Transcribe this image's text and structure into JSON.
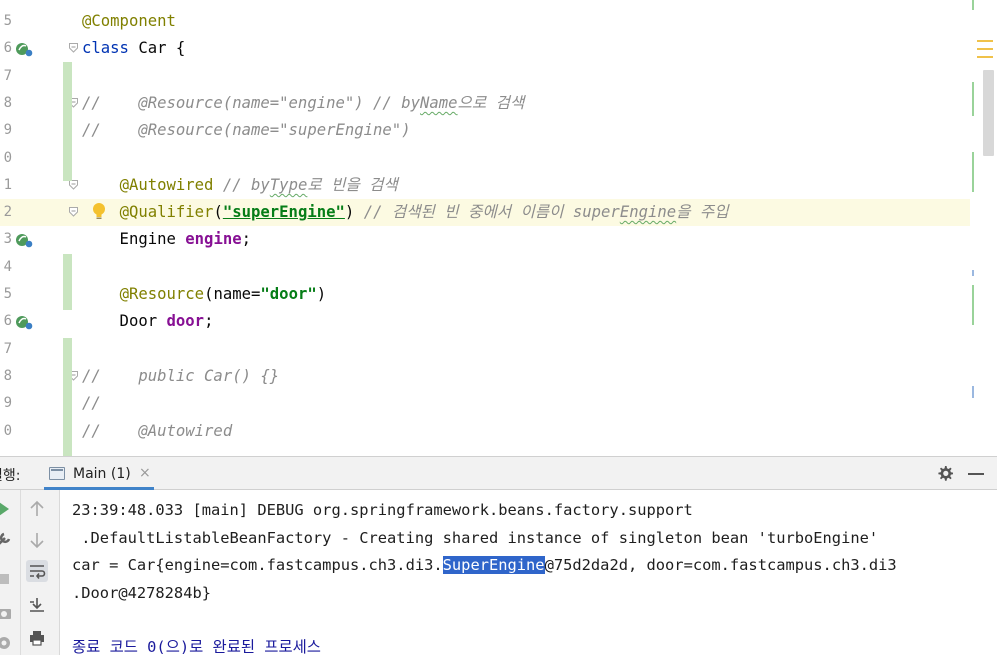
{
  "editor": {
    "lines": [
      {
        "num": "5",
        "segments": [
          {
            "t": "@Component",
            "c": "c-ann"
          }
        ]
      },
      {
        "num": "6",
        "segments": [
          {
            "t": "class",
            "c": "c-kw"
          },
          {
            "t": " Car {",
            "c": "c-plain"
          }
        ]
      },
      {
        "num": "7",
        "segments": []
      },
      {
        "num": "8",
        "segments": [
          {
            "t": "//    @Resource(name=\"engine\") // by",
            "c": "c-cmt"
          },
          {
            "t": "Name",
            "c": "c-cmt sq"
          },
          {
            "t": "으로 검색",
            "c": "c-cmt"
          }
        ]
      },
      {
        "num": "9",
        "segments": [
          {
            "t": "//    @Resource(name=\"superEngine\")",
            "c": "c-cmt"
          }
        ]
      },
      {
        "num": "0",
        "segments": []
      },
      {
        "num": "1",
        "segments": [
          {
            "t": "    ",
            "c": "c-plain"
          },
          {
            "t": "@Autowired",
            "c": "c-ann"
          },
          {
            "t": " // by",
            "c": "c-cmt"
          },
          {
            "t": "Type",
            "c": "c-cmt sq"
          },
          {
            "t": "로 빈을 검색",
            "c": "c-cmt"
          }
        ]
      },
      {
        "num": "2",
        "segments": [
          {
            "t": "    ",
            "c": "c-plain"
          },
          {
            "t": "@Qualifier",
            "c": "c-ann"
          },
          {
            "t": "(",
            "c": "c-plain"
          },
          {
            "t": "\"superEngine\"",
            "c": "c-str str-under"
          },
          {
            "t": ") ",
            "c": "c-plain"
          },
          {
            "t": "// 검색된 빈 중에서 이름이 super",
            "c": "c-cmt"
          },
          {
            "t": "Engine",
            "c": "c-cmt sq"
          },
          {
            "t": "을 주입",
            "c": "c-cmt"
          }
        ]
      },
      {
        "num": "3",
        "segments": [
          {
            "t": "    Engine ",
            "c": "c-plain"
          },
          {
            "t": "engine",
            "c": "c-field"
          },
          {
            "t": ";",
            "c": "c-plain"
          }
        ]
      },
      {
        "num": "4",
        "segments": []
      },
      {
        "num": "5",
        "segments": [
          {
            "t": "    ",
            "c": "c-plain"
          },
          {
            "t": "@Resource",
            "c": "c-ann"
          },
          {
            "t": "(name=",
            "c": "c-plain"
          },
          {
            "t": "\"door\"",
            "c": "c-str"
          },
          {
            "t": ")",
            "c": "c-plain"
          }
        ]
      },
      {
        "num": "6",
        "segments": [
          {
            "t": "    Door ",
            "c": "c-plain"
          },
          {
            "t": "door",
            "c": "c-field"
          },
          {
            "t": ";",
            "c": "c-plain"
          }
        ]
      },
      {
        "num": "7",
        "segments": []
      },
      {
        "num": "8",
        "segments": [
          {
            "t": "//    public Car() {}",
            "c": "c-cmt"
          }
        ]
      },
      {
        "num": "9",
        "segments": [
          {
            "t": "//",
            "c": "c-cmt"
          }
        ]
      },
      {
        "num": "0",
        "segments": [
          {
            "t": "//    @Autowired",
            "c": "c-cmt"
          }
        ]
      }
    ]
  },
  "run_window": {
    "title": "실행:",
    "tab_label": "Main (1)",
    "tab_close": "×"
  },
  "console": {
    "lines": [
      {
        "segments": [
          {
            "t": "23:39:48.033 [main] DEBUG org.springframework.beans.factory.support"
          }
        ]
      },
      {
        "segments": [
          {
            "t": " .DefaultListableBeanFactory - Creating shared instance of singleton bean 'turboEngine'"
          }
        ]
      },
      {
        "segments": [
          {
            "t": "car = Car{engine=com.fastcampus.ch3.di3."
          },
          {
            "t": "SuperEngine",
            "sel": true
          },
          {
            "t": "@75d2da2d, door=com.fastcampus.ch3.di3"
          }
        ]
      },
      {
        "segments": [
          {
            "t": ".Door@4278284b}"
          }
        ]
      },
      {
        "segments": []
      },
      {
        "segments": [
          {
            "t": "종료 코드 0(으)로 완료된 프로세스"
          }
        ]
      }
    ]
  },
  "colors": {
    "current_line": "#fcfae2",
    "selection": "#2f65ca",
    "annotation": "#808000",
    "keyword": "#0033b3",
    "string": "#067d17",
    "field": "#871094",
    "comment": "#8c8c8c"
  }
}
